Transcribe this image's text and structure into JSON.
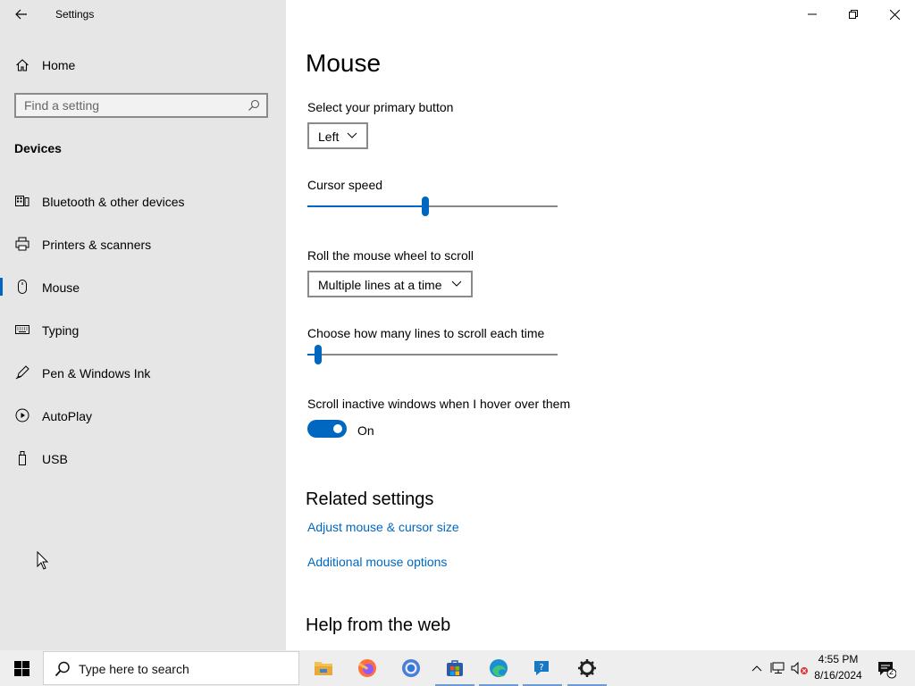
{
  "window": {
    "title": "Settings"
  },
  "sidebar": {
    "home_label": "Home",
    "search_placeholder": "Find a setting",
    "section_title": "Devices",
    "items": [
      {
        "label": "Bluetooth & other devices",
        "icon": "bluetooth-devices-icon"
      },
      {
        "label": "Printers & scanners",
        "icon": "printer-icon"
      },
      {
        "label": "Mouse",
        "icon": "mouse-icon",
        "selected": true
      },
      {
        "label": "Typing",
        "icon": "keyboard-icon"
      },
      {
        "label": "Pen & Windows Ink",
        "icon": "pen-icon"
      },
      {
        "label": "AutoPlay",
        "icon": "autoplay-icon"
      },
      {
        "label": "USB",
        "icon": "usb-icon"
      }
    ]
  },
  "main": {
    "title": "Mouse",
    "primary_button": {
      "label": "Select your primary button",
      "value": "Left"
    },
    "cursor_speed": {
      "label": "Cursor speed",
      "value_fraction": 0.47
    },
    "wheel": {
      "label": "Roll the mouse wheel to scroll",
      "value": "Multiple lines at a time"
    },
    "lines": {
      "label": "Choose how many lines to scroll each time",
      "value_fraction": 0.03
    },
    "inactive_scroll": {
      "label": "Scroll inactive windows when I hover over them",
      "state": "On"
    },
    "related": {
      "title": "Related settings",
      "links": [
        "Adjust mouse & cursor size",
        "Additional mouse options"
      ]
    },
    "help": {
      "title": "Help from the web"
    }
  },
  "taskbar": {
    "search_text": "Type here to search",
    "apps": [
      "file-explorer-icon",
      "firefox-icon",
      "chrome-icon",
      "store-icon",
      "edge-icon",
      "get-help-icon",
      "settings-gear-icon"
    ],
    "time": "4:55 PM",
    "date": "8/16/2024",
    "notification_count": "2"
  },
  "colors": {
    "accent": "#0067c0",
    "sidebar_bg": "#e6e6e6"
  }
}
